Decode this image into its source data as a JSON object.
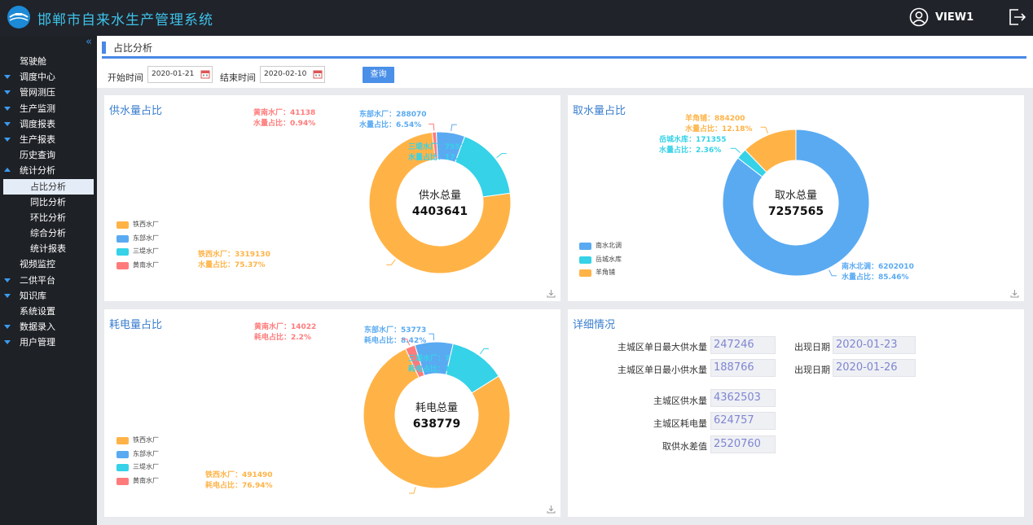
{
  "app": {
    "title": "邯郸市自来水生产管理系统",
    "user": "VIEW1"
  },
  "sidebar": {
    "collapse_icon": "«",
    "items": [
      {
        "label": "驾驶舱",
        "arrow": "none"
      },
      {
        "label": "调度中心",
        "arrow": "down"
      },
      {
        "label": "管网测压",
        "arrow": "down"
      },
      {
        "label": "生产监测",
        "arrow": "down"
      },
      {
        "label": "调度报表",
        "arrow": "down"
      },
      {
        "label": "生产报表",
        "arrow": "down"
      },
      {
        "label": "历史查询",
        "arrow": "none"
      },
      {
        "label": "统计分析",
        "arrow": "up"
      },
      {
        "label": "占比分析",
        "sub": true,
        "active": true
      },
      {
        "label": "同比分析",
        "sub": true
      },
      {
        "label": "环比分析",
        "sub": true
      },
      {
        "label": "综合分析",
        "sub": true
      },
      {
        "label": "统计报表",
        "sub": true
      },
      {
        "label": "视频监控",
        "arrow": "none"
      },
      {
        "label": "二供平台",
        "arrow": "down"
      },
      {
        "label": "知识库",
        "arrow": "down"
      },
      {
        "label": "系统设置",
        "arrow": "none"
      },
      {
        "label": "数据录入",
        "arrow": "down"
      },
      {
        "label": "用户管理",
        "arrow": "down"
      }
    ]
  },
  "page": {
    "tab": "占比分析",
    "start_label": "开始时间",
    "start_date": "2020-01-21",
    "end_label": "结束时间",
    "end_date": "2020-02-10",
    "query_button": "查询"
  },
  "colors": {
    "orange": "#ffb347",
    "blue": "#5aaaf2",
    "cyan": "#35d2e8",
    "red": "#ff7b7b",
    "accent": "#4a88e6"
  },
  "chart_data": [
    {
      "type": "pie",
      "title": "供水量占比",
      "center_title": "供水总量",
      "center_value": "4403641",
      "value_label": "水量占比",
      "slices": [
        {
          "name": "铁西水厂",
          "value": 3319130,
          "percent": "75.37%",
          "color": "#ffb347"
        },
        {
          "name": "东部水厂",
          "value": 288070,
          "percent": "6.54%",
          "color": "#5aaaf2"
        },
        {
          "name": "三堤水厂",
          "value": 755303,
          "percent": "17.15%",
          "color": "#35d2e8"
        },
        {
          "name": "黄南水厂",
          "value": 41138,
          "percent": "0.94%",
          "color": "#ff7b7b"
        }
      ],
      "legend": [
        "铁西水厂",
        "东部水厂",
        "三堤水厂",
        "黄南水厂"
      ]
    },
    {
      "type": "pie",
      "title": "取水量占比",
      "center_title": "取水总量",
      "center_value": "7257565",
      "value_label": "水量占比",
      "slices": [
        {
          "name": "南水北调",
          "value": 6202010,
          "percent": "85.46%",
          "color": "#5aaaf2"
        },
        {
          "name": "岳城水库",
          "value": 171355,
          "percent": "2.36%",
          "color": "#35d2e8"
        },
        {
          "name": "羊角铺",
          "value": 884200,
          "percent": "12.18%",
          "color": "#ffb347"
        }
      ],
      "legend": [
        "南水北调",
        "岳城水库",
        "羊角铺"
      ]
    },
    {
      "type": "pie",
      "title": "耗电量占比",
      "center_title": "耗电总量",
      "center_value": "638779",
      "value_label": "耗电占比",
      "slices": [
        {
          "name": "铁西水厂",
          "value": 491490,
          "percent": "76.94%",
          "color": "#ffb347"
        },
        {
          "name": "东部水厂",
          "value": 53773,
          "percent": "8.42%",
          "color": "#5aaaf2"
        },
        {
          "name": "三堤水厂",
          "value": 79494,
          "percent": "12.44%",
          "color": "#35d2e8"
        },
        {
          "name": "黄南水厂",
          "value": 14022,
          "percent": "2.2%",
          "color": "#ff7b7b"
        }
      ],
      "legend": [
        "铁西水厂",
        "东部水厂",
        "三堤水厂",
        "黄南水厂"
      ]
    }
  ],
  "details": {
    "title": "详细情况",
    "max_supply_label": "主城区单日最大供水量",
    "max_supply_value": "247246",
    "max_date_label": "出现日期",
    "max_date_value": "2020-01-23",
    "min_supply_label": "主城区单日最小供水量",
    "min_supply_value": "188766",
    "min_date_label": "出现日期",
    "min_date_value": "2020-01-26",
    "supply_label": "主城区供水量",
    "supply_value": "4362503",
    "power_label": "主城区耗电量",
    "power_value": "624757",
    "diff_label": "取供水差值",
    "diff_value": "2520760"
  },
  "icons": {
    "logo": "water-logo",
    "user": "user-icon",
    "logout": "logout-icon",
    "calendar": "calendar-icon",
    "download": "download-icon"
  }
}
